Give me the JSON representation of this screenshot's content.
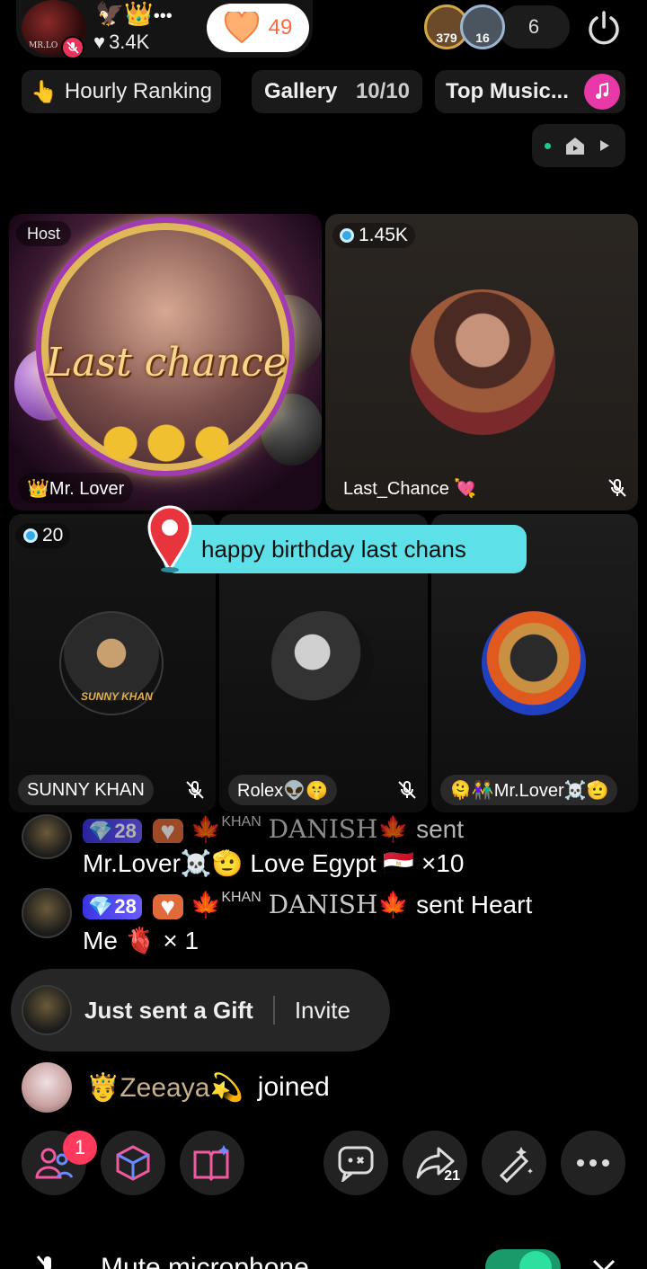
{
  "header": {
    "host_avatar_label": "MR.LO",
    "likes": "3.4K",
    "heart_count": "49",
    "viewer_badges": [
      "379",
      "16"
    ],
    "viewer_count": "6"
  },
  "chips": {
    "ranking": "Hourly Ranking",
    "gallery": "Gallery",
    "gallery_ratio": "10/10",
    "music": "Top Music..."
  },
  "seats": {
    "host_tag": "Host",
    "host_title": "Last chance",
    "host_name": "👑Mr. Lover",
    "s2_score": "1.45K",
    "s2_name": "Last_Chance 💘",
    "s3_score": "20",
    "s3_name": "SUNNY KHAN",
    "s3_avatar_label": "SUNNY KHAN",
    "s4_name": "Rolex👽🤫",
    "s5_name": "🫠👫Mr.Lover☠️🫡"
  },
  "banner": {
    "text": "happy birthday last chans"
  },
  "chat": [
    {
      "level": "28",
      "sender_prefix": "KHAN",
      "sender": "DANISH",
      "line1": "sent",
      "line2": "Mr.Lover☠️🫡 Love Egypt 🇪🇬 ×10"
    },
    {
      "level": "28",
      "sender_prefix": "KHAN",
      "sender": "DANISH",
      "line1": "sent Heart",
      "line2": "Me 🫀 × 1"
    }
  ],
  "gift_pill": {
    "text": "Just sent a Gift",
    "invite": "Invite"
  },
  "join": {
    "name": "Zeeaya",
    "action": "joined"
  },
  "toolbar": {
    "notif_count": "1",
    "share_count": "21"
  },
  "mute_bar": {
    "text": "Mute microphone"
  }
}
